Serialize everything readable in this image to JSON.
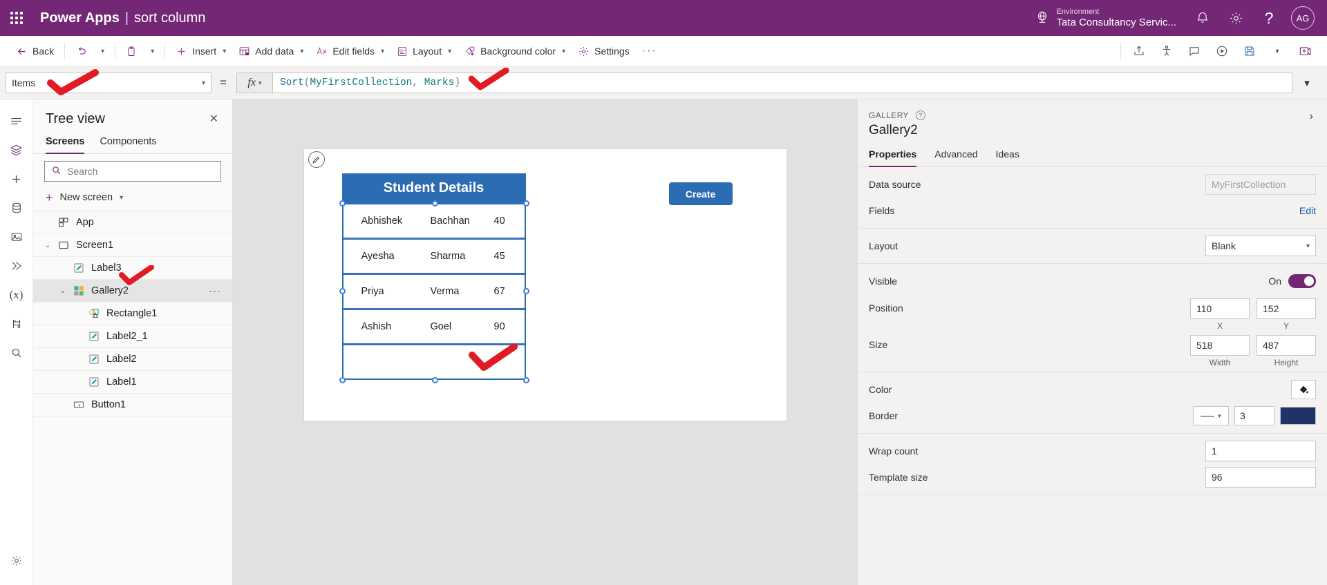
{
  "topbar": {
    "waffle_icon": "waffle-grid-icon",
    "brand": "Power Apps",
    "divider": "|",
    "app_name": "sort column",
    "environment_label": "Environment",
    "environment_name": "Tata Consultancy Servic...",
    "globe_icon": "globe-icon",
    "bell_icon": "notification-bell-icon",
    "gear_icon": "settings-gear-icon",
    "help_icon": "help-question-icon",
    "avatar_initials": "AG",
    "accent": "#742774"
  },
  "commandbar": {
    "back": "Back",
    "undo_icon": "undo-arrow-icon",
    "paste_icon": "clipboard-paste-icon",
    "insert": "Insert",
    "add_data": "Add data",
    "edit_fields": "Edit fields",
    "layout": "Layout",
    "background_color": "Background color",
    "settings": "Settings",
    "overflow": "···",
    "right_icons": [
      "share-icon",
      "check-accessibility-icon",
      "comments-icon",
      "play-preview-icon",
      "save-icon",
      "save-chevron-icon",
      "publish-icon"
    ]
  },
  "formulabar": {
    "property": "Items",
    "equals": "=",
    "fx": "fx",
    "formula_tokens": [
      {
        "t": "Sort",
        "c": "fn"
      },
      {
        "t": "(",
        "c": "p"
      },
      {
        "t": "MyFirstCollection",
        "c": "id"
      },
      {
        "t": ", ",
        "c": "p"
      },
      {
        "t": "Marks",
        "c": "id"
      },
      {
        "t": ")",
        "c": "p"
      }
    ],
    "formula_text": "Sort(MyFirstCollection, Marks)",
    "expand_icon": "chevron-down-icon"
  },
  "rail": {
    "items": [
      {
        "icon": "hamburger-menu-icon",
        "name": "menu"
      },
      {
        "icon": "tree-view-layers-icon",
        "name": "tree-view",
        "active": true
      },
      {
        "icon": "insert-plus-icon",
        "name": "insert"
      },
      {
        "icon": "data-cylinder-icon",
        "name": "data"
      },
      {
        "icon": "media-image-icon",
        "name": "media"
      },
      {
        "icon": "power-automate-icon",
        "name": "power-automate"
      },
      {
        "icon": "variables-x-icon",
        "name": "variables"
      },
      {
        "icon": "monitor-icon",
        "name": "monitor"
      },
      {
        "icon": "search-icon",
        "name": "search"
      },
      {
        "icon": "settings-gear-icon",
        "name": "app-settings"
      }
    ]
  },
  "treeview": {
    "title": "Tree view",
    "close_icon": "close-x-icon",
    "tabs": [
      {
        "label": "Screens",
        "active": true
      },
      {
        "label": "Components",
        "active": false
      }
    ],
    "search_placeholder": "Search",
    "search_value": "",
    "search_icon": "search-icon",
    "new_screen": "New screen",
    "items": [
      {
        "label": "App",
        "icon": "app-grid-icon",
        "indent": 0,
        "caret": "",
        "selected": false,
        "dots": false
      },
      {
        "label": "Screen1",
        "icon": "screen-rect-icon",
        "indent": 0,
        "caret": "⌄",
        "selected": false,
        "dots": false
      },
      {
        "label": "Label3",
        "icon": "label-pencil-icon",
        "indent": 1,
        "caret": "",
        "selected": false,
        "dots": false
      },
      {
        "label": "Gallery2",
        "icon": "gallery-squares-icon",
        "indent": 1,
        "caret": "⌄",
        "selected": true,
        "dots": true
      },
      {
        "label": "Rectangle1",
        "icon": "shapes-icon",
        "indent": 2,
        "caret": "",
        "selected": false,
        "dots": false
      },
      {
        "label": "Label2_1",
        "icon": "label-pencil-icon",
        "indent": 2,
        "caret": "",
        "selected": false,
        "dots": false
      },
      {
        "label": "Label2",
        "icon": "label-pencil-icon",
        "indent": 2,
        "caret": "",
        "selected": false,
        "dots": false
      },
      {
        "label": "Label1",
        "icon": "label-pencil-icon",
        "indent": 2,
        "caret": "",
        "selected": false,
        "dots": false
      },
      {
        "label": "Button1",
        "icon": "button-icon",
        "indent": 1,
        "caret": "",
        "selected": false,
        "dots": false
      }
    ]
  },
  "canvas": {
    "gallery_title": "Student Details",
    "title_bg": "#2b6cb3",
    "create_button": "Create",
    "edit_badge_icon": "edit-pencil-icon",
    "rows": [
      {
        "first": "Abhishek",
        "last": "Bachhan",
        "marks": "40"
      },
      {
        "first": "Ayesha",
        "last": "Sharma",
        "marks": "45"
      },
      {
        "first": "Priya",
        "last": "Verma",
        "marks": "67"
      },
      {
        "first": "Ashish",
        "last": "Goel",
        "marks": "90"
      }
    ]
  },
  "properties": {
    "kind": "GALLERY",
    "help_icon": "help-question-icon",
    "name": "Gallery2",
    "expand_icon": "chevron-right-icon",
    "tabs": [
      {
        "label": "Properties",
        "active": true
      },
      {
        "label": "Advanced",
        "active": false
      },
      {
        "label": "Ideas",
        "active": false
      }
    ],
    "data_source_label": "Data source",
    "data_source_value": "MyFirstCollection",
    "fields_label": "Fields",
    "fields_action": "Edit",
    "layout_label": "Layout",
    "layout_value": "Blank",
    "visible_label": "Visible",
    "visible_state": "On",
    "position_label": "Position",
    "position_x": "110",
    "position_y": "152",
    "position_x_cap": "X",
    "position_y_cap": "Y",
    "size_label": "Size",
    "size_width": "518",
    "size_height": "487",
    "size_width_cap": "Width",
    "size_height_cap": "Height",
    "color_label": "Color",
    "color_icon": "paint-bucket-icon",
    "border_label": "Border",
    "border_width": "3",
    "border_color": "#1f3368",
    "wrap_count_label": "Wrap count",
    "wrap_count_value": "1",
    "template_size_label": "Template size",
    "template_size_value": "96"
  },
  "annotations": {
    "color": "#e01b24",
    "marks": [
      {
        "name": "checkmark-items-property"
      },
      {
        "name": "checkmark-formula"
      },
      {
        "name": "checkmark-gallery2-tree"
      },
      {
        "name": "checkmark-gallery-sorted"
      }
    ]
  }
}
